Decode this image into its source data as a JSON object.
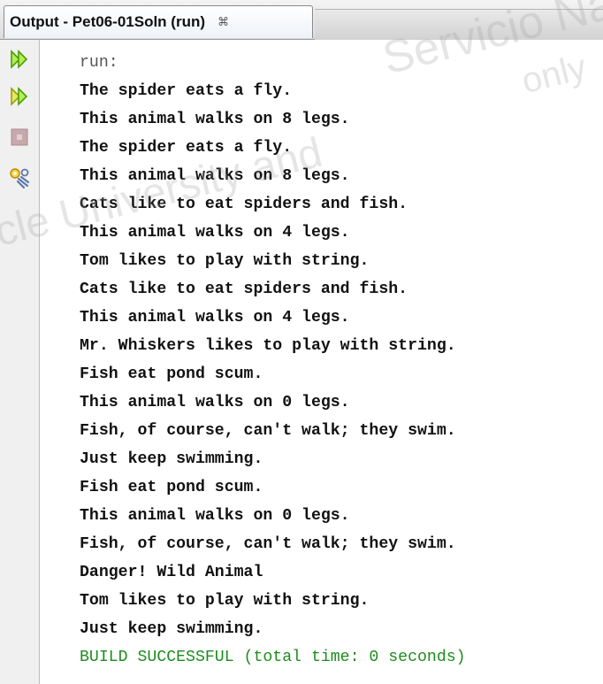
{
  "tab": {
    "title": "Output - Pet06-01Soln (run)",
    "close_glyph": "⌘"
  },
  "toolbar": {
    "buttons": [
      {
        "name": "rerun-icon"
      },
      {
        "name": "rerun-with-options-icon"
      },
      {
        "name": "stop-icon"
      },
      {
        "name": "settings-icon"
      }
    ]
  },
  "output": {
    "run_label": "run:",
    "lines": [
      "The spider eats a fly.",
      "This animal walks on 8 legs.",
      "The spider eats a fly.",
      "This animal walks on 8 legs.",
      "Cats like to eat spiders and fish.",
      "This animal walks on 4 legs.",
      "Tom likes to play with string.",
      "Cats like to eat spiders and fish.",
      "This animal walks on 4 legs.",
      "Mr. Whiskers likes to play with string.",
      "Fish eat pond scum.",
      "This animal walks on 0 legs.",
      "Fish, of course, can't walk; they swim.",
      "Just keep swimming.",
      "Fish eat pond scum.",
      "This animal walks on 0 legs.",
      "Fish, of course, can't walk; they swim.",
      "Danger! Wild Animal",
      "Tom likes to play with string.",
      "Just keep swimming."
    ],
    "build_status": "BUILD SUCCESSFUL (total time: 0 seconds)"
  },
  "watermark": {
    "segments": [
      "Servicio Nac",
      "only",
      "cle University and"
    ]
  },
  "colors": {
    "success": "#1e8c1e",
    "run_icon": "#5cc400"
  }
}
